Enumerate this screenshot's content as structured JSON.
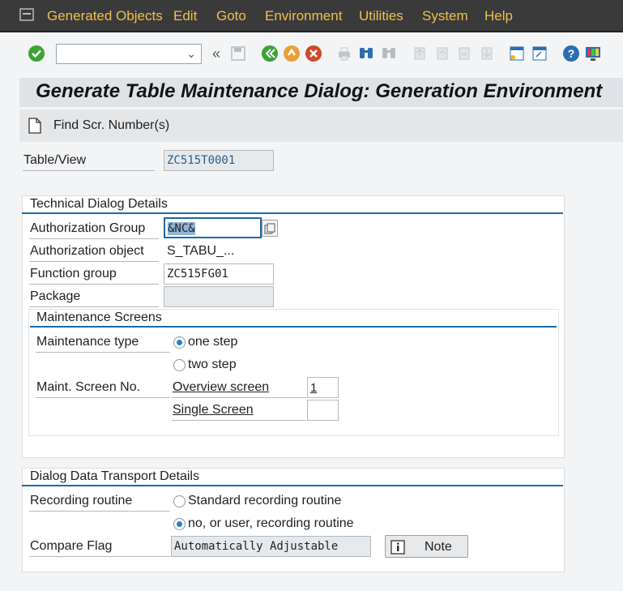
{
  "menu": {
    "items": [
      "Generated Objects",
      "Edit",
      "Goto",
      "Environment",
      "Utilities",
      "System",
      "Help"
    ]
  },
  "toolbar": {
    "command_value": "",
    "icons": [
      "enter-icon",
      "back-icon",
      "exit-icon",
      "cancel-icon",
      "print-icon",
      "find-icon",
      "find-next-icon",
      "first-page-icon",
      "previous-page-icon",
      "next-page-icon",
      "last-page-icon",
      "create-session-icon",
      "shortcut-icon",
      "help-icon",
      "customize-icon"
    ]
  },
  "title": "Generate Table Maintenance Dialog: Generation Environment",
  "app_toolbar": {
    "find_screens_label": "Find Scr. Number(s)"
  },
  "table_view": {
    "label": "Table/View",
    "value": "ZC515T0001"
  },
  "technical": {
    "title": "Technical Dialog Details",
    "auth_group_label": "Authorization Group",
    "auth_group_value": "&NC&",
    "auth_object_label": "Authorization object",
    "auth_object_value": "S_TABU_...",
    "function_group_label": "Function group",
    "function_group_value": "ZC515FG01",
    "package_label": "Package",
    "package_value": ""
  },
  "maintenance_screens": {
    "title": "Maintenance Screens",
    "type_label": "Maintenance type",
    "one_step": "one step",
    "two_step": "two step",
    "selected": "one step",
    "screen_no_label": "Maint. Screen No.",
    "overview_label": "Overview screen",
    "overview_value": "1",
    "single_label": "Single Screen",
    "single_value": ""
  },
  "transport": {
    "title": "Dialog Data Transport Details",
    "recording_label": "Recording routine",
    "standard": "Standard recording routine",
    "user": "no, or user, recording routine",
    "selected": "no, or user, recording routine",
    "compare_label": "Compare Flag",
    "compare_value": "Automatically Adjustable",
    "note_label": "Note"
  },
  "colors": {
    "menu_bg": "#3a3a3a",
    "menu_text": "#f0c052",
    "accent": "#1c6aa5",
    "ok_green": "#3aa335",
    "nav_orange": "#e8a03a",
    "cancel_red": "#d04a2a"
  }
}
